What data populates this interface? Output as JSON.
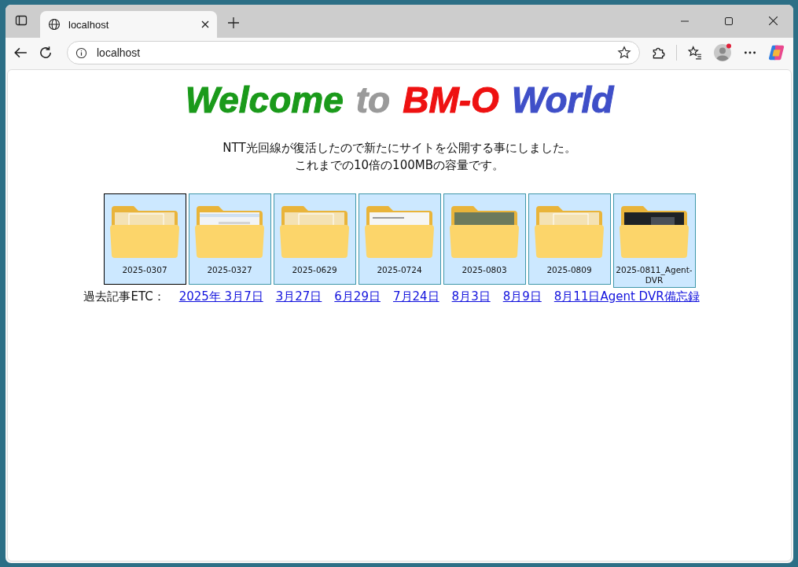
{
  "browser": {
    "tab": {
      "title": "localhost"
    },
    "address": "localhost"
  },
  "heading": [
    {
      "text": "Welcome",
      "color": "#1a9a1a"
    },
    {
      "text": "to",
      "color": "#9a9a9a"
    },
    {
      "text": "BM-O",
      "color": "#ee1111"
    },
    {
      "text": "World",
      "color": "#3f4fc8"
    }
  ],
  "intro": [
    "NTT光回線が復活したので新たにサイトを公開する事にしました。",
    "これまでの10倍の100MBの容量です。"
  ],
  "folders": [
    {
      "label": "2025-0307",
      "selected": true,
      "kind": "page"
    },
    {
      "label": "2025-0327",
      "selected": false,
      "kind": "screenshot"
    },
    {
      "label": "2025-0629",
      "selected": false,
      "kind": "page"
    },
    {
      "label": "2025-0724",
      "selected": false,
      "kind": "document"
    },
    {
      "label": "2025-0803",
      "selected": false,
      "kind": "photo"
    },
    {
      "label": "2025-0809",
      "selected": false,
      "kind": "page"
    },
    {
      "label": "2025-0811_Agent-DVR",
      "selected": false,
      "kind": "dark"
    }
  ],
  "archive": {
    "label": "過去記事ETC：",
    "links": [
      "2025年 3月7日",
      "3月27日",
      "6月29日",
      "7月24日",
      "8月3日",
      "8月9日",
      "8月11日Agent DVR備忘録"
    ]
  }
}
